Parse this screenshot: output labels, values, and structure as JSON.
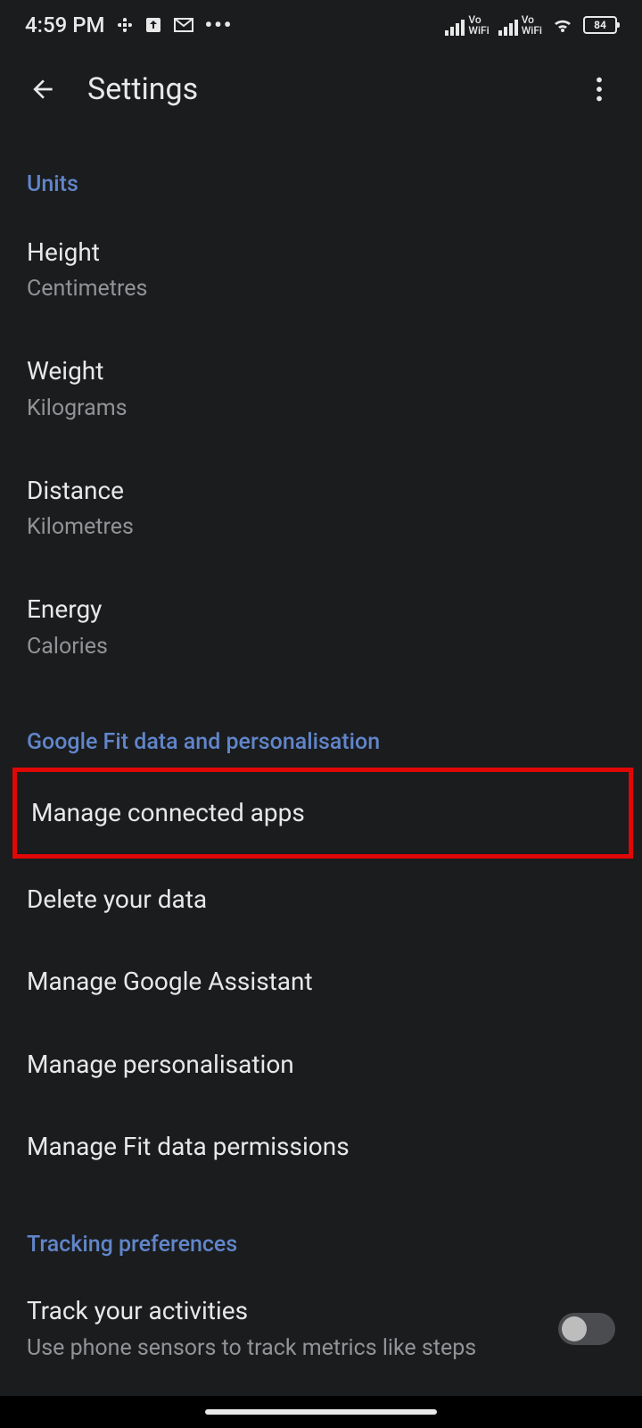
{
  "status": {
    "time": "4:59 PM",
    "vowifi": "Vo\nWiFi",
    "battery": "84"
  },
  "header": {
    "title": "Settings"
  },
  "sections": {
    "units": {
      "header": "Units",
      "items": [
        {
          "title": "Height",
          "subtitle": "Centimetres"
        },
        {
          "title": "Weight",
          "subtitle": "Kilograms"
        },
        {
          "title": "Distance",
          "subtitle": "Kilometres"
        },
        {
          "title": "Energy",
          "subtitle": "Calories"
        }
      ]
    },
    "gfit": {
      "header": "Google Fit data and personalisation",
      "items": [
        {
          "title": "Manage connected apps"
        },
        {
          "title": "Delete your data"
        },
        {
          "title": "Manage Google Assistant"
        },
        {
          "title": "Manage personalisation"
        },
        {
          "title": "Manage Fit data permissions"
        }
      ]
    },
    "tracking": {
      "header": "Tracking preferences",
      "item": {
        "title": "Track your activities",
        "subtitle": "Use phone sensors to track metrics like steps"
      }
    }
  }
}
